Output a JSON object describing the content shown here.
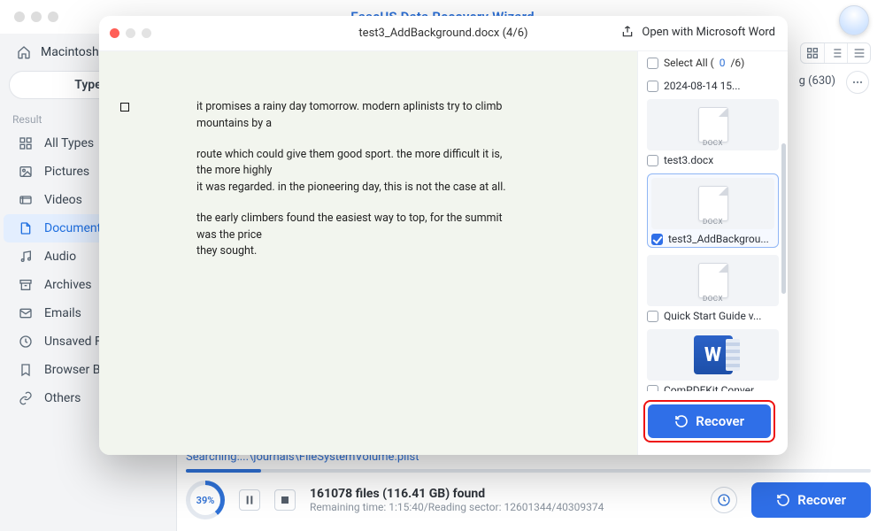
{
  "app": {
    "title": "EaseUS Data Recovery Wizard"
  },
  "breadcrumb": "Macintosh",
  "type_pill": "Type",
  "result_label": "Result",
  "sidebar": {
    "items": [
      {
        "label": "All Types"
      },
      {
        "label": "Pictures"
      },
      {
        "label": "Videos"
      },
      {
        "label": "Documents"
      },
      {
        "label": "Audio"
      },
      {
        "label": "Archives"
      },
      {
        "label": "Emails"
      },
      {
        "label": "Unsaved Files"
      },
      {
        "label": "Browser Bookmarks"
      },
      {
        "label": "Others"
      }
    ]
  },
  "behind": {
    "g_badge": "g (630)"
  },
  "search_line": "Searching:...\\journals\\FileSystemVolume.plist",
  "scan": {
    "percent": "39%",
    "found_main": "161078 files (116.41 GB) found",
    "found_sub": "Remaining time: 1:15:40/Reading sector: 12601344/40309374"
  },
  "btn": {
    "recover": "Recover",
    "modal_recover": "Recover"
  },
  "modal": {
    "title": "test3_AddBackground.docx (4/6)",
    "open_with": "Open with Microsoft Word",
    "select_all_label": "Select All (",
    "select_all_sel": "0",
    "select_all_total": "/6)",
    "preview": {
      "p1": "it promises a rainy day tomorrow. modern aplinists try to climb mountains by a",
      "p2a": "route which could give them good sport. the more difficult it is, the more highly",
      "p2b": "it was regarded. in the pioneering day, this is not the case at all.",
      "p3a": "the early climbers found the easiest way to top, for the summit was the price",
      "p3b": "they sought."
    },
    "files": [
      {
        "name": "2024-08-14 15...",
        "ext": "",
        "checked": false,
        "thumb": false
      },
      {
        "name": "test3.docx",
        "ext": "DOCX",
        "checked": false,
        "thumb": true
      },
      {
        "name": "test3_AddBackgrou...",
        "ext": "DOCX",
        "checked": true,
        "thumb": true,
        "active": true
      },
      {
        "name": "Quick Start Guide v...",
        "ext": "DOCX",
        "checked": false,
        "thumb": true
      },
      {
        "name": "ComPDFKit Conver...",
        "ext": "WORD",
        "checked": false,
        "thumb": true,
        "word": true
      }
    ]
  }
}
